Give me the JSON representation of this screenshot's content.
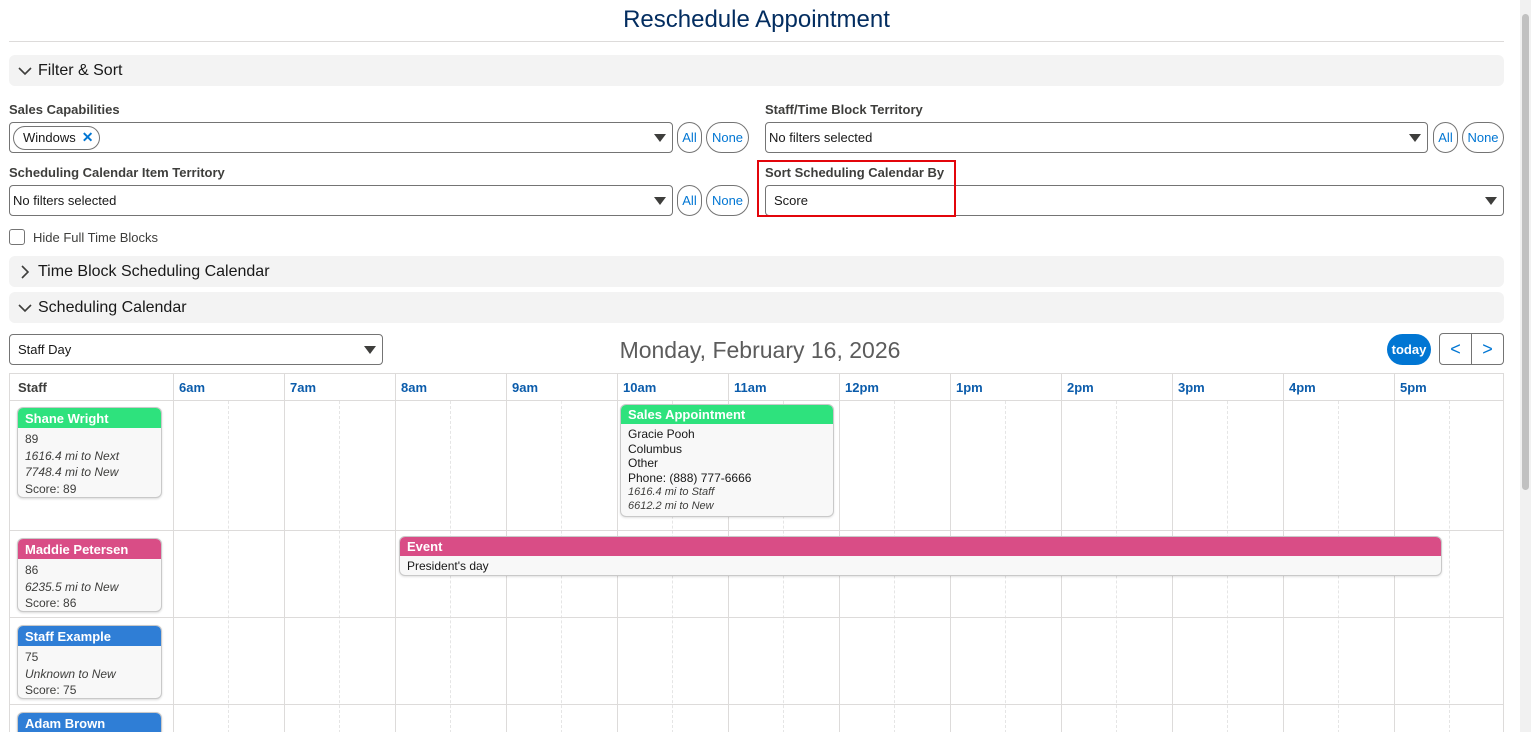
{
  "page": {
    "title": "Reschedule Appointment"
  },
  "sections": {
    "filter_sort": "Filter & Sort",
    "time_block_calendar": "Time Block Scheduling Calendar",
    "scheduling_calendar": "Scheduling Calendar"
  },
  "filters": {
    "sales_capabilities": {
      "label": "Sales Capabilities",
      "pill": "Windows",
      "all": "All",
      "none": "None"
    },
    "staff_territory": {
      "label": "Staff/Time Block Territory",
      "value": "No filters selected",
      "all": "All",
      "none": "None"
    },
    "item_territory": {
      "label": "Scheduling Calendar Item Territory",
      "value": "No filters selected",
      "all": "All",
      "none": "None"
    },
    "sort_by": {
      "label": "Sort Scheduling Calendar By",
      "value": "Score"
    },
    "hide_full": {
      "label": "Hide Full Time Blocks",
      "checked": false
    }
  },
  "calendar": {
    "view": "Staff Day",
    "date_title": "Monday, February 16, 2026",
    "today": "today",
    "prev": "<",
    "next": ">",
    "staff_header": "Staff",
    "hours": [
      "6am",
      "7am",
      "8am",
      "9am",
      "10am",
      "11am",
      "12pm",
      "1pm",
      "2pm",
      "3pm",
      "4pm",
      "5pm"
    ],
    "staff": [
      {
        "name": "Shane Wright",
        "color": "#2ee27d",
        "score_num": "89",
        "lines": [
          "1616.4 mi to Next",
          "7748.4 mi to New"
        ],
        "score": "Score: 89"
      },
      {
        "name": "Maddie Petersen",
        "color": "#d94d86",
        "score_num": "86",
        "lines": [
          "6235.5 mi to New"
        ],
        "score": "Score: 86"
      },
      {
        "name": "Staff Example",
        "color": "#2f7ed6",
        "score_num": "75",
        "lines": [
          "Unknown to New"
        ],
        "score": "Score: 75"
      },
      {
        "name": "Adam Brown",
        "color": "#2f7ed6"
      }
    ],
    "events": {
      "sales_appt": {
        "title": "Sales Appointment",
        "color": "#2ee27d",
        "lines": [
          "Gracie Pooh",
          "Columbus",
          "Other",
          "Phone: (888) 777-6666"
        ],
        "distance": [
          "1616.4 mi to Staff",
          "6612.2 mi to New"
        ]
      },
      "event": {
        "title": "Event",
        "color": "#d94d86",
        "text": "President's day"
      }
    }
  }
}
